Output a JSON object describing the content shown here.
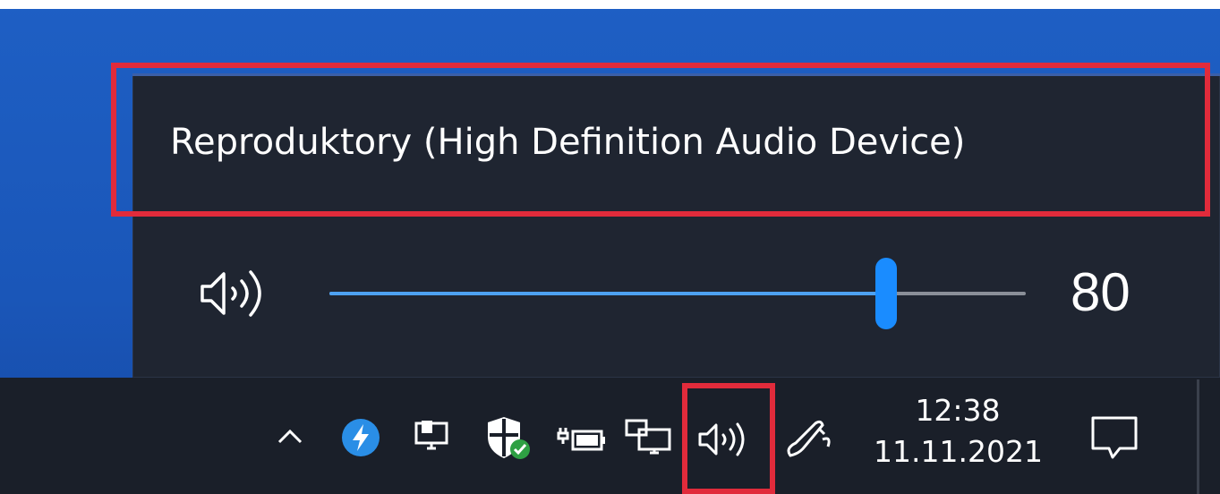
{
  "volume_flyout": {
    "device_name": "Reproduktory (High Definition Audio Device)",
    "volume_value": "80",
    "volume_level": 80,
    "speaker_icon": "speaker-icon",
    "accent_color": "#1a8cff",
    "highlight_color": "#e12b3b"
  },
  "taskbar": {
    "tray_icons": [
      "chevron-up-icon",
      "sync-app-icon",
      "network-icon",
      "security-shield-icon",
      "battery-icon",
      "network-wired-icon",
      "speaker-icon",
      "pen-icon"
    ],
    "clock": {
      "time": "12:38",
      "date": "11.11.2021"
    },
    "notification_icon": "action-center-icon"
  }
}
